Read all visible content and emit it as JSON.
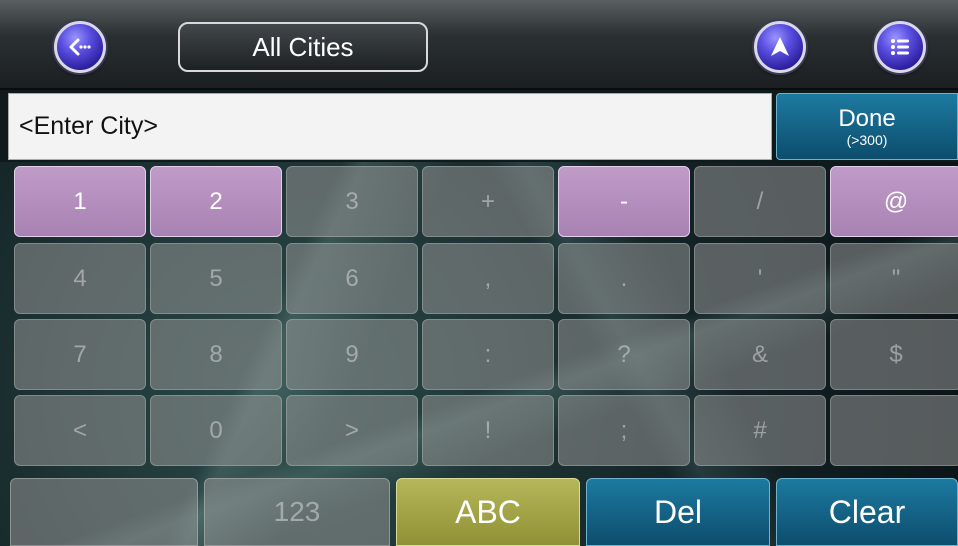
{
  "header": {
    "title": "All Cities",
    "back_icon": "back-arrow-icon",
    "nav_icon": "navigation-arrow-icon",
    "menu_icon": "list-menu-icon"
  },
  "search": {
    "placeholder": "<Enter City>",
    "done_label": "Done",
    "done_count": "(>300)"
  },
  "keyboard": {
    "rows": [
      [
        {
          "label": "1",
          "active": true
        },
        {
          "label": "2",
          "active": true
        },
        {
          "label": "3",
          "active": false
        },
        {
          "label": "+",
          "active": false
        },
        {
          "label": "-",
          "active": true
        },
        {
          "label": "/",
          "active": false
        },
        {
          "label": "@",
          "active": true
        }
      ],
      [
        {
          "label": "4",
          "active": false
        },
        {
          "label": "5",
          "active": false
        },
        {
          "label": "6",
          "active": false
        },
        {
          "label": ",",
          "active": false
        },
        {
          "label": ".",
          "active": false
        },
        {
          "label": "'",
          "active": false
        },
        {
          "label": "\"",
          "active": false
        }
      ],
      [
        {
          "label": "7",
          "active": false
        },
        {
          "label": "8",
          "active": false
        },
        {
          "label": "9",
          "active": false
        },
        {
          "label": ":",
          "active": false
        },
        {
          "label": "?",
          "active": false
        },
        {
          "label": "&",
          "active": false
        },
        {
          "label": "$",
          "active": false
        }
      ],
      [
        {
          "label": "<",
          "active": false
        },
        {
          "label": "0",
          "active": false
        },
        {
          "label": ">",
          "active": false
        },
        {
          "label": "!",
          "active": false
        },
        {
          "label": ";",
          "active": false
        },
        {
          "label": "#",
          "active": false
        },
        {
          "label": "",
          "active": false
        }
      ]
    ],
    "bottom": {
      "mode_123": "123",
      "mode_abc": "ABC",
      "del": "Del",
      "clear": "Clear"
    }
  },
  "colors": {
    "active_key": "#b08cbb",
    "abc_key": "#a3a548",
    "action_key": "#135f83",
    "inactive_key": "#8a8f90"
  }
}
